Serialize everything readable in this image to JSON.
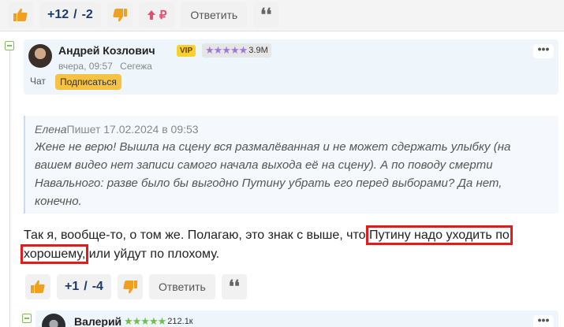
{
  "top_toolbar": {
    "score_plus": "+12",
    "score_sep": "/",
    "score_minus": "-2",
    "rub_label": "₽",
    "reply_label": "Ответить",
    "quote_glyph": "❛❛"
  },
  "comment": {
    "author": "Андрей Козлович",
    "vip_label": "VIP",
    "stars": "★★★★★",
    "rating_count": "3.9M",
    "time": "вчера, 09:57",
    "place": "Сегежа",
    "chat_label": "Чат",
    "subscribe_label": "Подписаться",
    "more_label": "•••",
    "quote": {
      "name": "Елена",
      "wrote": "Пишет 17.02.2024 в 09:53",
      "text": "Жене не верю! Вышла на сцену вся размалёванная и не может сдержать улыбку (на вашем видео нет записи самого начала выхода её на сцену). А по поводу смерти Навального: разве было бы выгодно Путину убрать его перед выборами? Да нет, конечно."
    },
    "body_part1": "Так я, вообще-то, о том же. Полагаю, это знак с выше, что ",
    "body_highlight1": "Путину надо уходить по",
    "body_highlight2": "хорошему,",
    "body_part2": " или уйдут по плохому."
  },
  "comment_toolbar": {
    "score_plus": "+1",
    "score_sep": "/",
    "score_minus": "-4",
    "reply_label": "Ответить",
    "quote_glyph": "❛❛"
  },
  "child_comment": {
    "author": "Валерий",
    "stars": "★★★★★",
    "rating_count": "212.1к",
    "more_label": "•••"
  },
  "colors": {
    "like": "#f0a020",
    "dislike": "#f0a020",
    "score": "#1b3a6e",
    "highlight": "#e01c1c"
  }
}
